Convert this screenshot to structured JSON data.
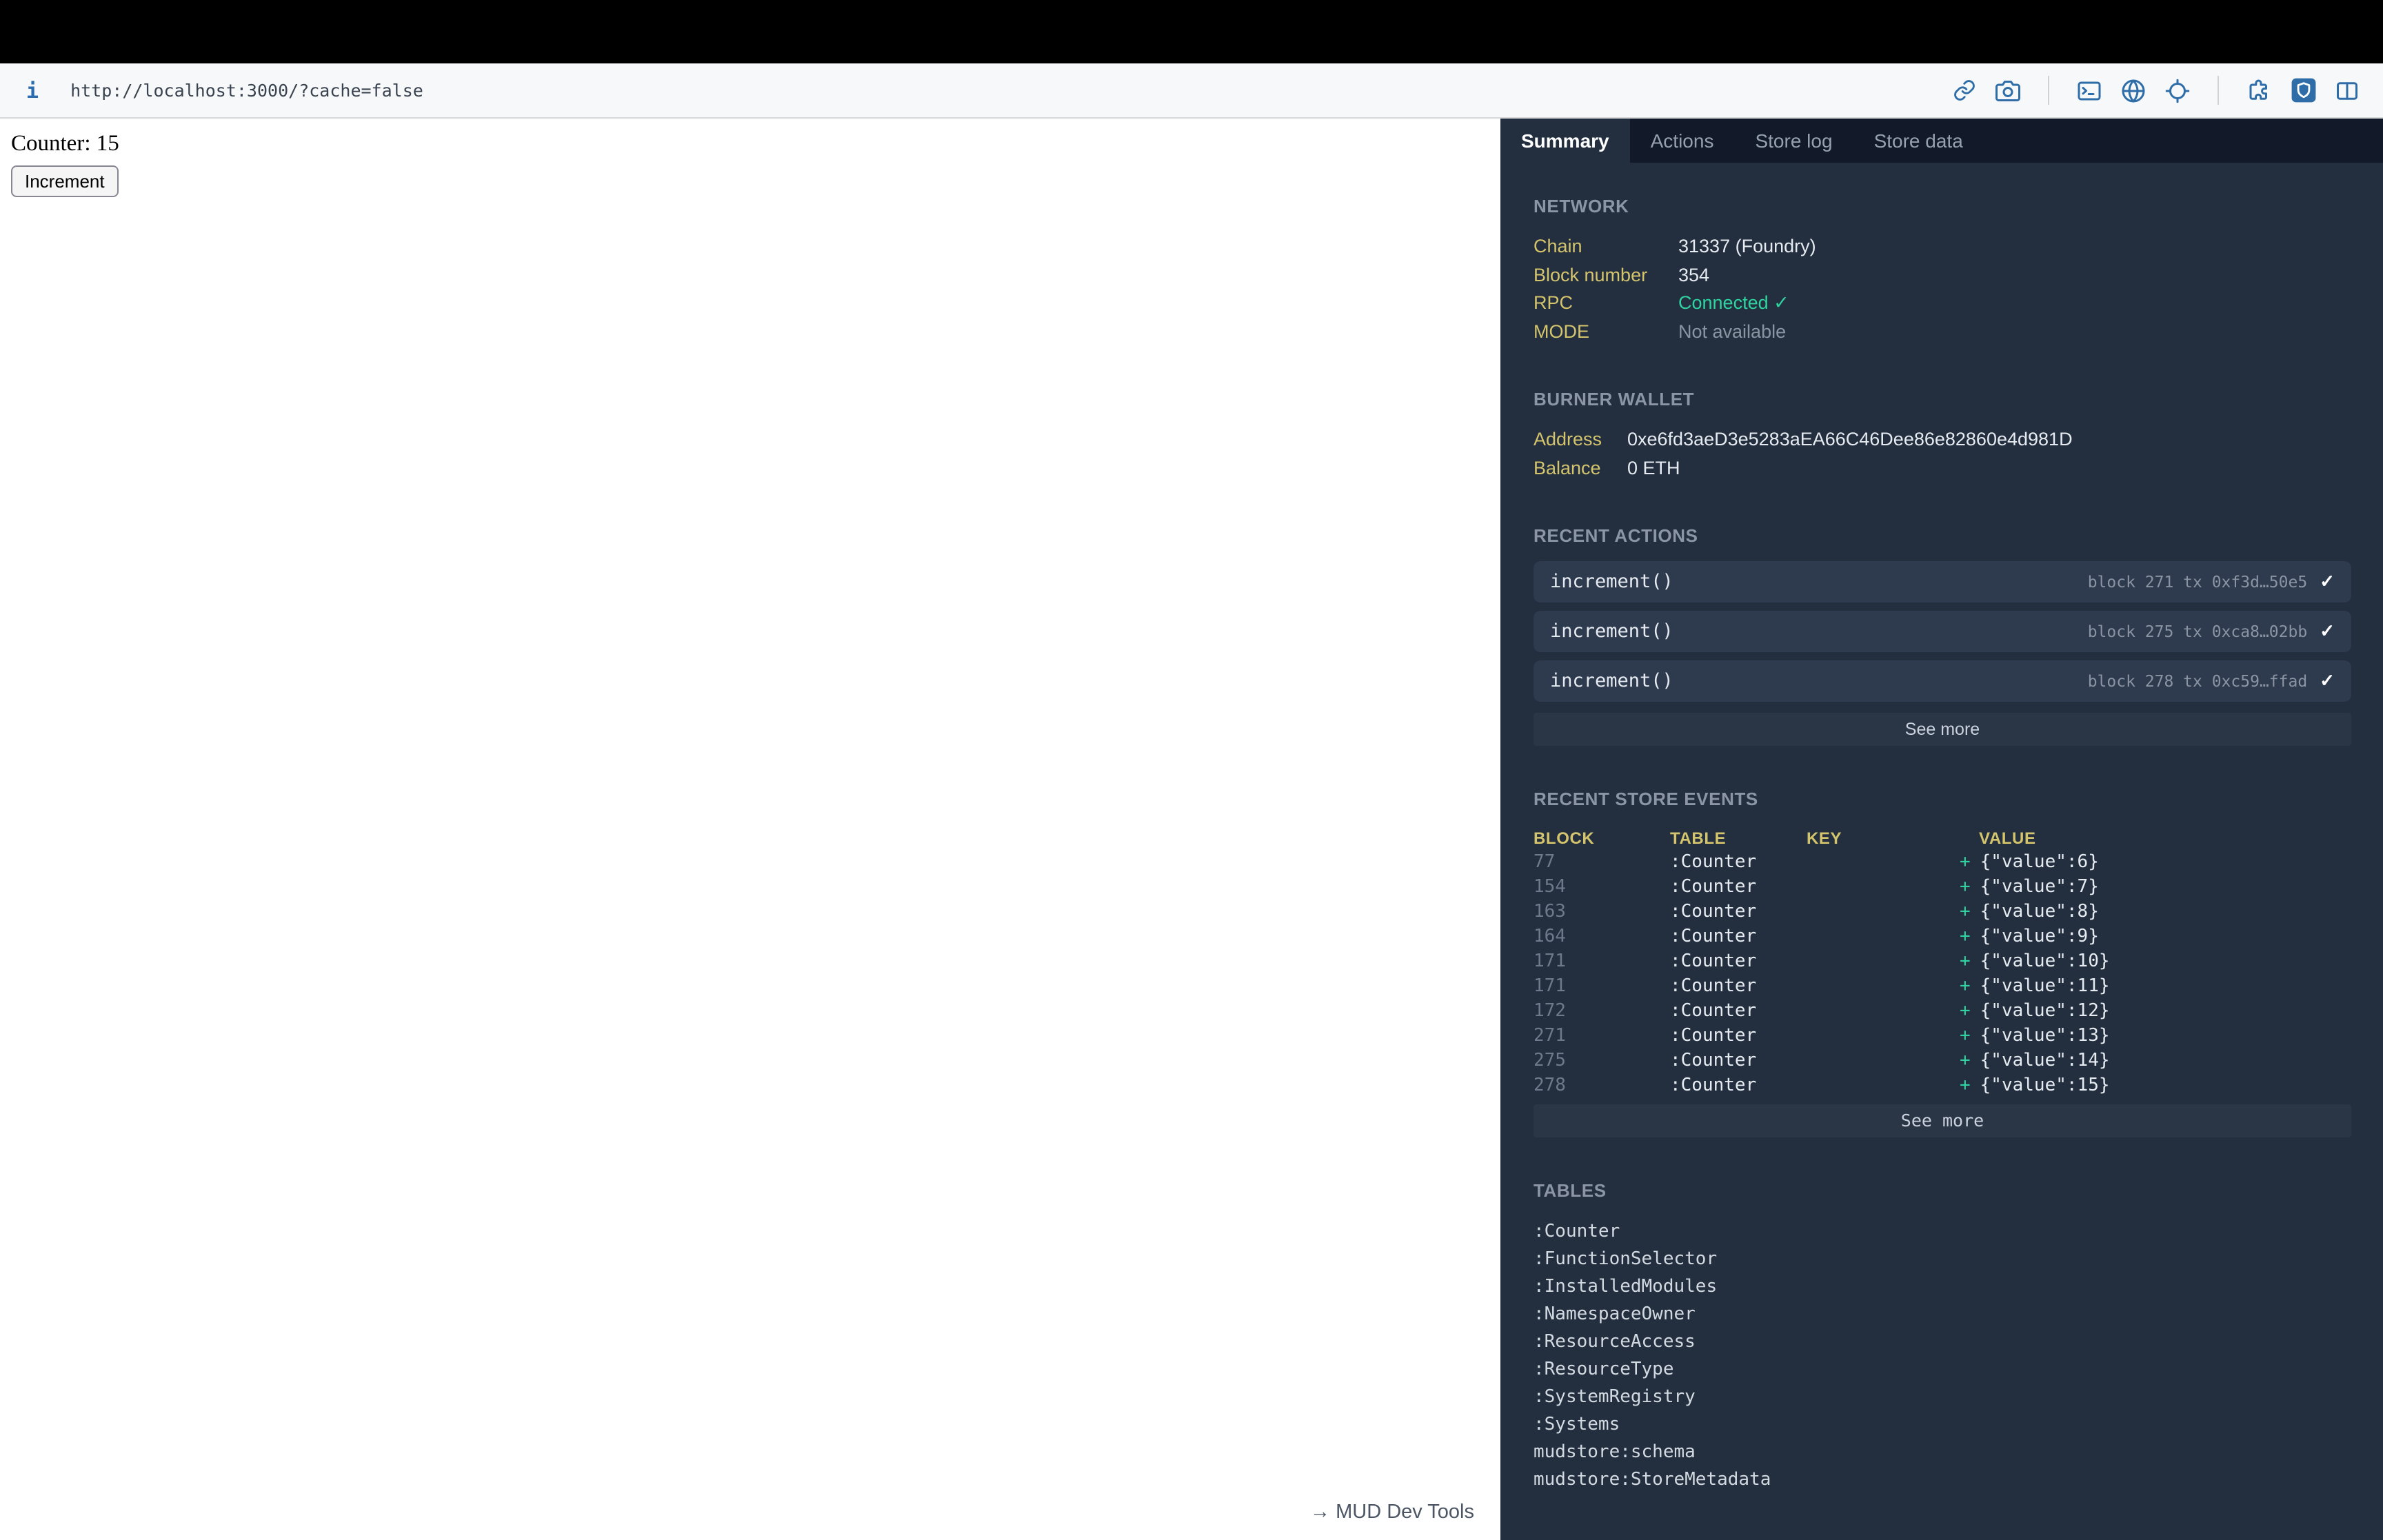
{
  "browser": {
    "info_icon_glyph": "i",
    "url": "http://localhost:3000/?cache=false",
    "toolbar_icons": [
      "link-icon",
      "screenshot-icon",
      "terminal-icon",
      "globe-icon",
      "target-icon",
      "extensions-icon",
      "shield-icon",
      "split-view-icon"
    ]
  },
  "page": {
    "counter_text": "Counter: 15",
    "increment_button_label": "Increment",
    "devtools_toggle_label": "→ MUD Dev Tools"
  },
  "devtools": {
    "tabs": [
      {
        "label": "Summary",
        "active": true
      },
      {
        "label": "Actions",
        "active": false
      },
      {
        "label": "Store log",
        "active": false
      },
      {
        "label": "Store data",
        "active": false
      }
    ],
    "network": {
      "title": "NETWORK",
      "rows": [
        {
          "label": "Chain",
          "value": "31337 (Foundry)"
        },
        {
          "label": "Block number",
          "value": "354"
        },
        {
          "label": "RPC",
          "value": "Connected ✓"
        },
        {
          "label": "MODE",
          "value": "Not available"
        }
      ]
    },
    "burner_wallet": {
      "title": "BURNER WALLET",
      "rows": [
        {
          "label": "Address",
          "value": "0xe6fd3aeD3e5283aEA66C46Dee86e82860e4d981D"
        },
        {
          "label": "Balance",
          "value": "0 ETH"
        }
      ]
    },
    "recent_actions": {
      "title": "RECENT ACTIONS",
      "check_mark": "✓",
      "see_more_label": "See more",
      "items": [
        {
          "name": "increment()",
          "meta": "block 271 tx 0xf3d…50e5"
        },
        {
          "name": "increment()",
          "meta": "block 275 tx 0xca8…02bb"
        },
        {
          "name": "increment()",
          "meta": "block 278 tx 0xc59…ffad"
        }
      ]
    },
    "recent_store_events": {
      "title": "RECENT STORE EVENTS",
      "plus_marker": "+",
      "see_more_label": "See more",
      "headers": [
        "BLOCK",
        "TABLE",
        "KEY",
        "VALUE"
      ],
      "rows": [
        {
          "block": "77",
          "table": ":Counter",
          "key": "",
          "value": "{\"value\":6}"
        },
        {
          "block": "154",
          "table": ":Counter",
          "key": "",
          "value": "{\"value\":7}"
        },
        {
          "block": "163",
          "table": ":Counter",
          "key": "",
          "value": "{\"value\":8}"
        },
        {
          "block": "164",
          "table": ":Counter",
          "key": "",
          "value": "{\"value\":9}"
        },
        {
          "block": "171",
          "table": ":Counter",
          "key": "",
          "value": "{\"value\":10}"
        },
        {
          "block": "171",
          "table": ":Counter",
          "key": "",
          "value": "{\"value\":11}"
        },
        {
          "block": "172",
          "table": ":Counter",
          "key": "",
          "value": "{\"value\":12}"
        },
        {
          "block": "271",
          "table": ":Counter",
          "key": "",
          "value": "{\"value\":13}"
        },
        {
          "block": "275",
          "table": ":Counter",
          "key": "",
          "value": "{\"value\":14}"
        },
        {
          "block": "278",
          "table": ":Counter",
          "key": "",
          "value": "{\"value\":15}"
        }
      ]
    },
    "tables": {
      "title": "TABLES",
      "items": [
        ":Counter",
        ":FunctionSelector",
        ":InstalledModules",
        ":NamespaceOwner",
        ":ResourceAccess",
        ":ResourceType",
        ":SystemRegistry",
        ":Systems",
        "mudstore:schema",
        "mudstore:StoreMetadata"
      ]
    }
  },
  "colors": {
    "toolbar_icon_blue": "#2e6da8",
    "panel_bg": "#232f3f",
    "tabbar_bg": "#121a29",
    "label_amber": "#d4c46c",
    "success_green": "#30d3a0",
    "muted_gray": "#8a94a3",
    "action_row_bg": "#2e3a4d"
  }
}
